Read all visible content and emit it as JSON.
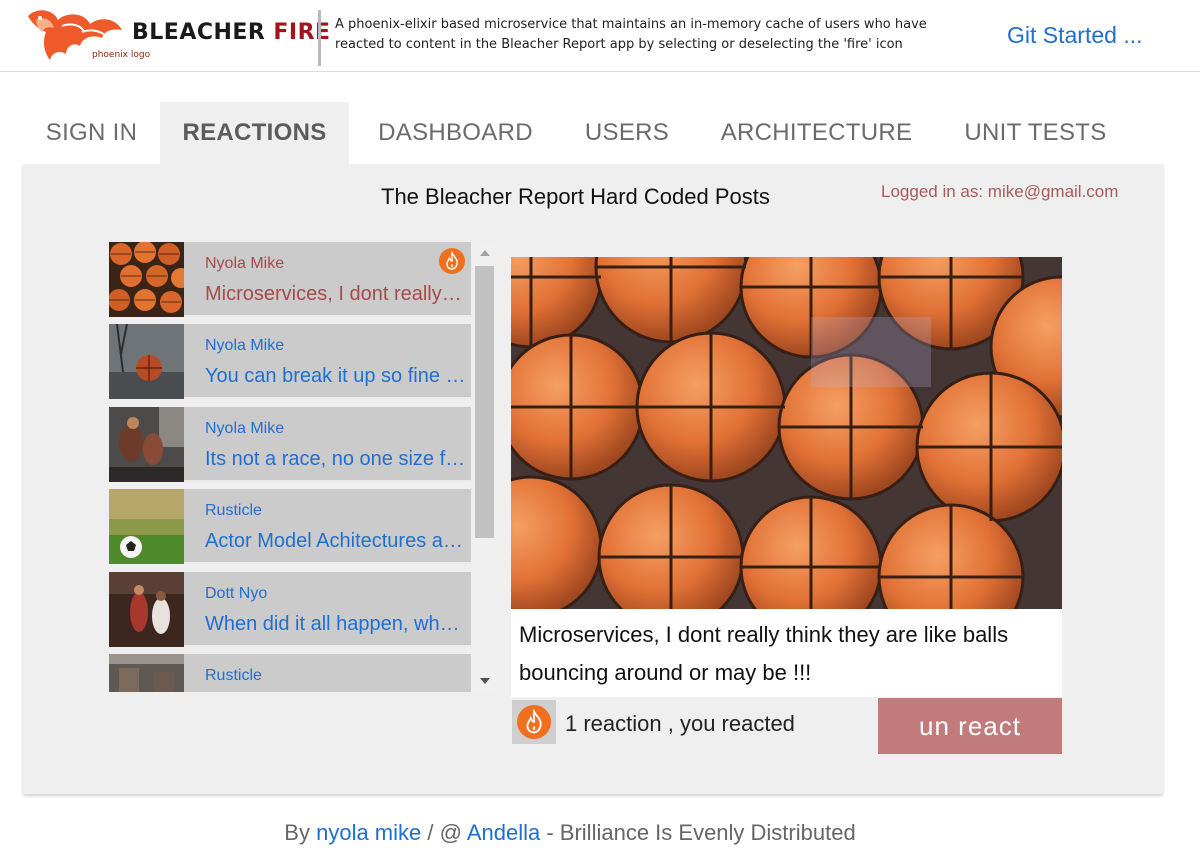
{
  "header": {
    "logo_caption": "phoenix logo",
    "brand_part1": "BLEACHER",
    "brand_part2": "FIRE",
    "tagline": "A phoenix-elixir based microservice that maintains an in-memory cache of users who have reacted to content in the Bleacher Report app by selecting or deselecting the 'fire' icon",
    "git_link": "Git Started ..."
  },
  "tabs": [
    {
      "label": "SIGN IN",
      "active": false
    },
    {
      "label": "REACTIONS",
      "active": true
    },
    {
      "label": "DASHBOARD",
      "active": false
    },
    {
      "label": "USERS",
      "active": false
    },
    {
      "label": "ARCHITECTURE",
      "active": false
    },
    {
      "label": "UNIT TESTS",
      "active": false
    }
  ],
  "panel": {
    "title": "The Bleacher Report Hard Coded Posts",
    "logged_in": "Logged in as: mike@gmail.com"
  },
  "posts": [
    {
      "author": "Nyola Mike",
      "excerpt": "Microservices, I dont really think they are like balls bouncing around or may be !!!",
      "thumb": "basketballs",
      "selected": true,
      "reacted": true
    },
    {
      "author": "Nyola Mike",
      "excerpt": "You can break it up so fine grained",
      "thumb": "basketball-court",
      "selected": false,
      "reacted": false
    },
    {
      "author": "Nyola Mike",
      "excerpt": "Its not a race, no one size fits all",
      "thumb": "players",
      "selected": false,
      "reacted": false
    },
    {
      "author": "Rusticle",
      "excerpt": "Actor Model Achitectures are the way",
      "thumb": "soccer-ball",
      "selected": false,
      "reacted": false
    },
    {
      "author": "Dott Nyo",
      "excerpt": "When did it all happen, what went wrong",
      "thumb": "match",
      "selected": false,
      "reacted": false
    },
    {
      "author": "Rusticle",
      "excerpt": "",
      "thumb": "arena",
      "selected": false,
      "reacted": false
    }
  ],
  "detail": {
    "text": "Microservices, I dont really think they are like balls bouncing around or may be !!!",
    "reaction_text": "1 reaction , you reacted",
    "unreact_label": "un react"
  },
  "footer": {
    "by": "By",
    "author_link": "nyola mike",
    "sep": "/ @",
    "org_link": "Andella",
    "motto": "- Brilliance Is Evenly Distributed"
  },
  "colors": {
    "accent_link": "#1f6fd1",
    "selected_text": "#a84a4a",
    "unreact_button": "#c27b7b",
    "fire_orange": "#f07020",
    "brand_red": "#a3141c"
  },
  "icons": {
    "fire": "fire-icon",
    "scroll_up": "chevron-up-icon",
    "scroll_down": "chevron-down-icon",
    "logo": "phoenix-logo"
  }
}
